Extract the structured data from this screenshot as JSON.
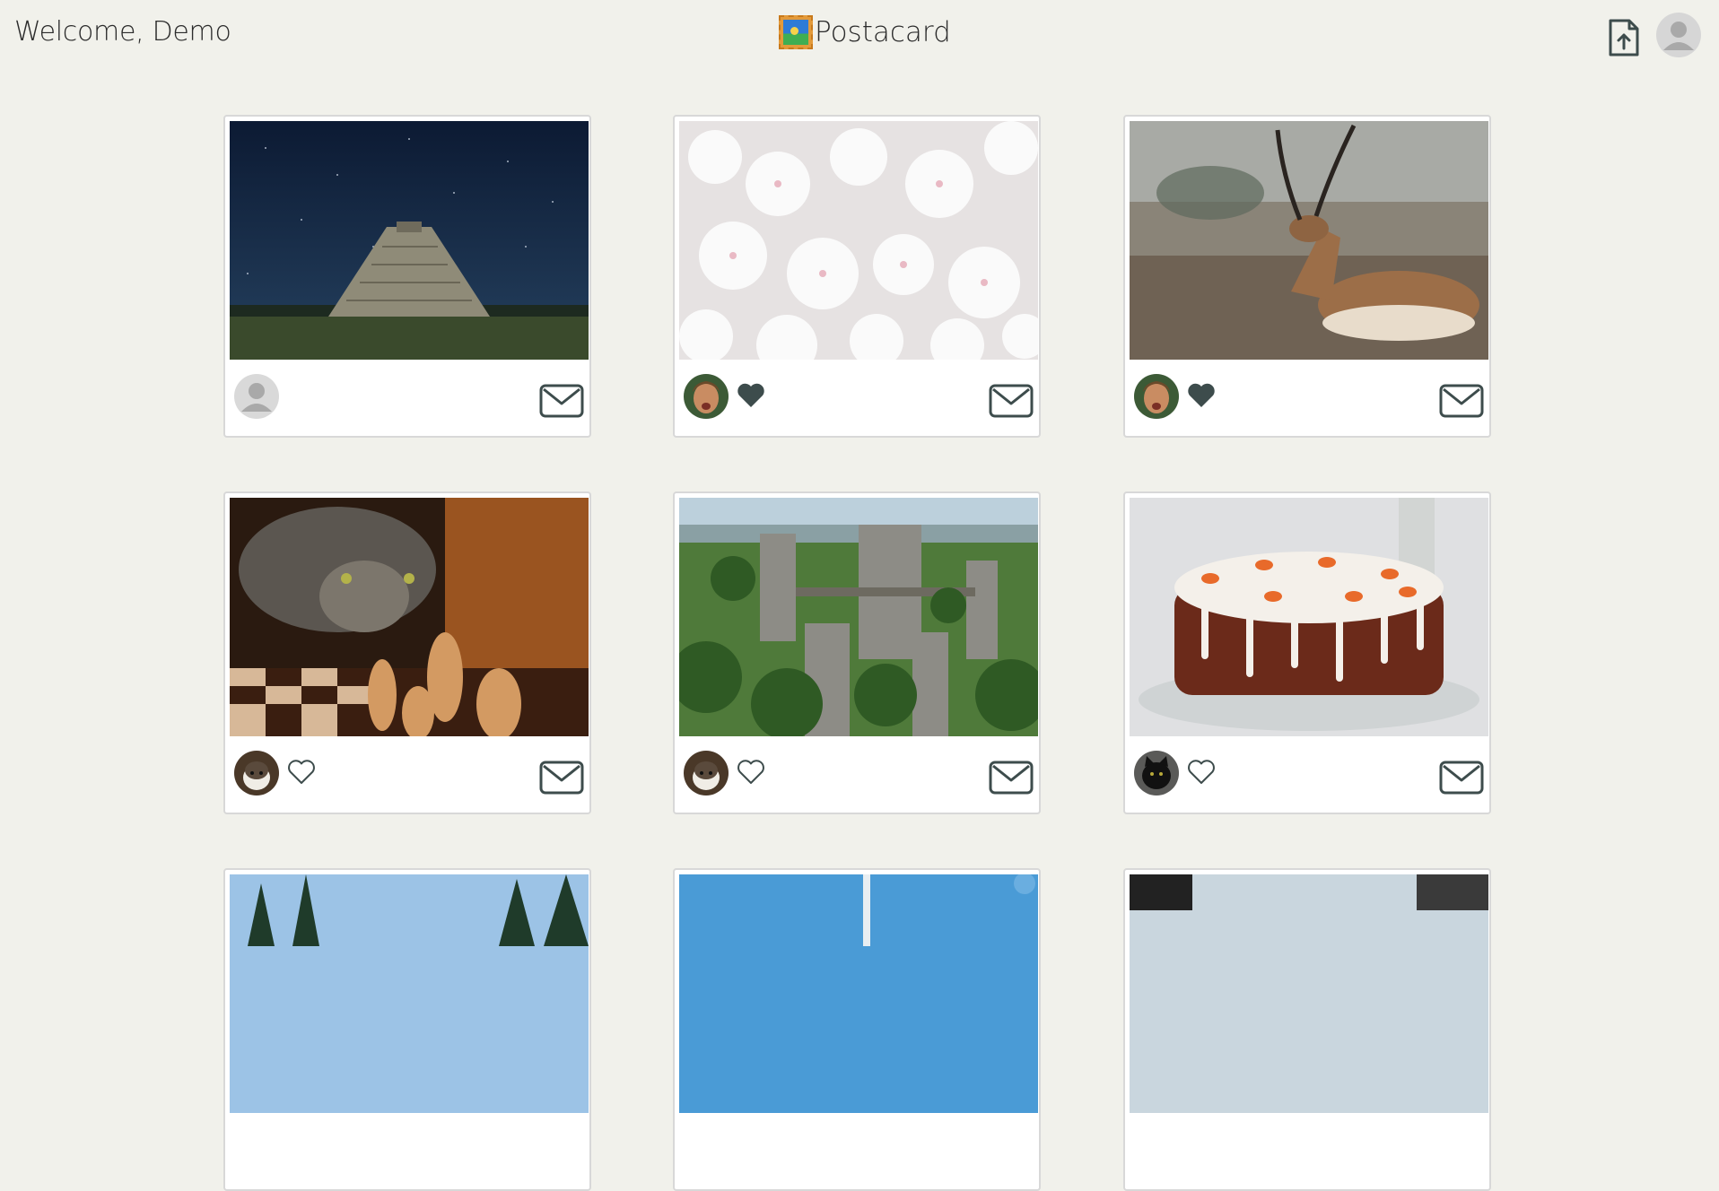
{
  "header": {
    "welcome": "Welcome, Demo",
    "brand": "Postacard"
  },
  "colors": {
    "background": "#f1f1eb",
    "icon": "#3d4c4c"
  },
  "cards": [
    {
      "photo": "pyramid-night-sky",
      "user": "default-avatar",
      "liked": null
    },
    {
      "photo": "cherry-blossoms",
      "user": "man-avatar",
      "liked": true
    },
    {
      "photo": "antelope",
      "user": "man-avatar",
      "liked": true
    },
    {
      "photo": "cat-chess",
      "user": "cat-avatar",
      "liked": false
    },
    {
      "photo": "rock-bridge-forest",
      "user": "cat-avatar",
      "liked": false
    },
    {
      "photo": "carrot-cake",
      "user": "black-cat-avatar",
      "liked": false
    },
    {
      "photo": "forest-trees",
      "user": null,
      "liked": null
    },
    {
      "photo": "blue-sky",
      "user": null,
      "liked": null
    },
    {
      "photo": "cloudy-mountain",
      "user": null,
      "liked": null
    }
  ]
}
